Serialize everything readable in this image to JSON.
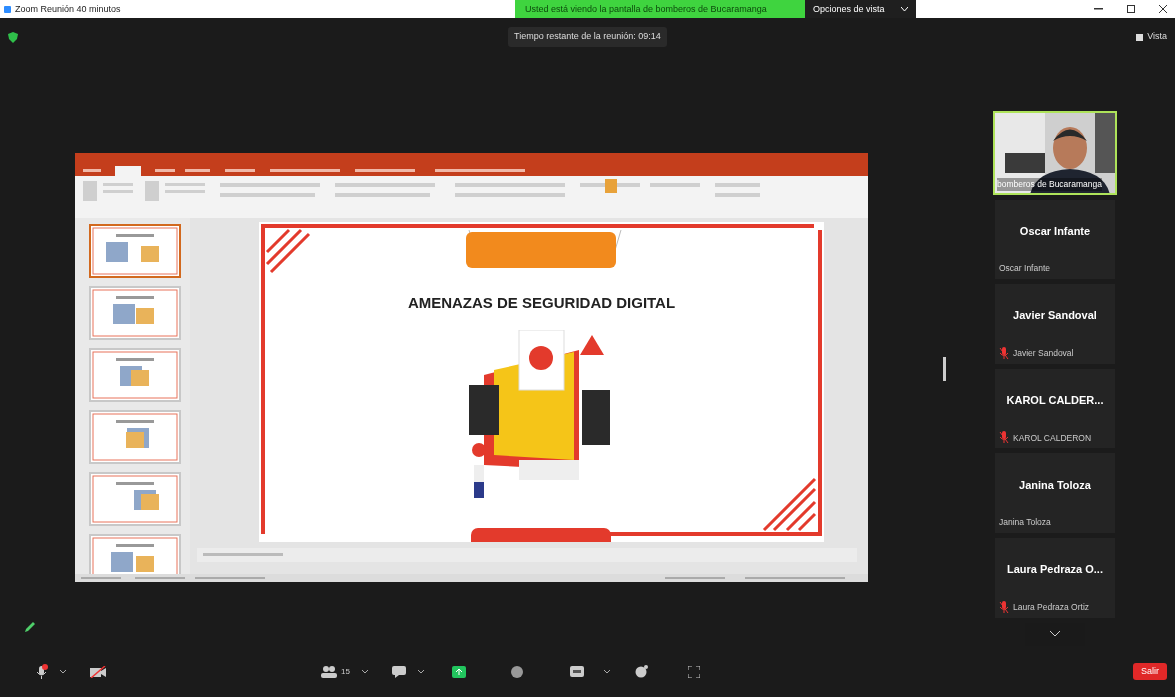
{
  "window": {
    "title": "Zoom Reunión 40 minutos"
  },
  "share_banner": {
    "text": "Usted está viendo la pantalla de bomberos de Bucaramanga",
    "button": "Opciones de vista"
  },
  "timer": "Tiempo restante de la reunión: 09:14",
  "view_button": "Vista",
  "shared_screen": {
    "slide_title": "AMENAZAS DE SEGURIDAD DIGITAL",
    "thumbnails": [
      {
        "selected": true
      },
      {
        "selected": false
      },
      {
        "selected": false
      },
      {
        "selected": false
      },
      {
        "selected": false
      },
      {
        "selected": false
      }
    ]
  },
  "participants": [
    {
      "kind": "video",
      "label": "bomberos de Bucaramanga",
      "speaking": true
    },
    {
      "kind": "name",
      "display": "Oscar Infante",
      "label": "Oscar Infante",
      "speaking": false,
      "muted": false
    },
    {
      "kind": "name",
      "display": "Javier Sandoval",
      "label": "Javier Sandoval",
      "speaking": false,
      "muted": true
    },
    {
      "kind": "name",
      "display": "KAROL CALDER...",
      "label": "KAROL CALDERON",
      "speaking": false,
      "muted": true
    },
    {
      "kind": "name",
      "display": "Janina Toloza",
      "label": "Janina Toloza",
      "speaking": false,
      "muted": false
    },
    {
      "kind": "name",
      "display": "Laura Pedraza O...",
      "label": "Laura Pedraza Ortiz",
      "speaking": false,
      "muted": true
    }
  ],
  "toolbar": {
    "mic_muted": true,
    "video_on": false,
    "participants_count": "15",
    "leave": "Salir"
  }
}
